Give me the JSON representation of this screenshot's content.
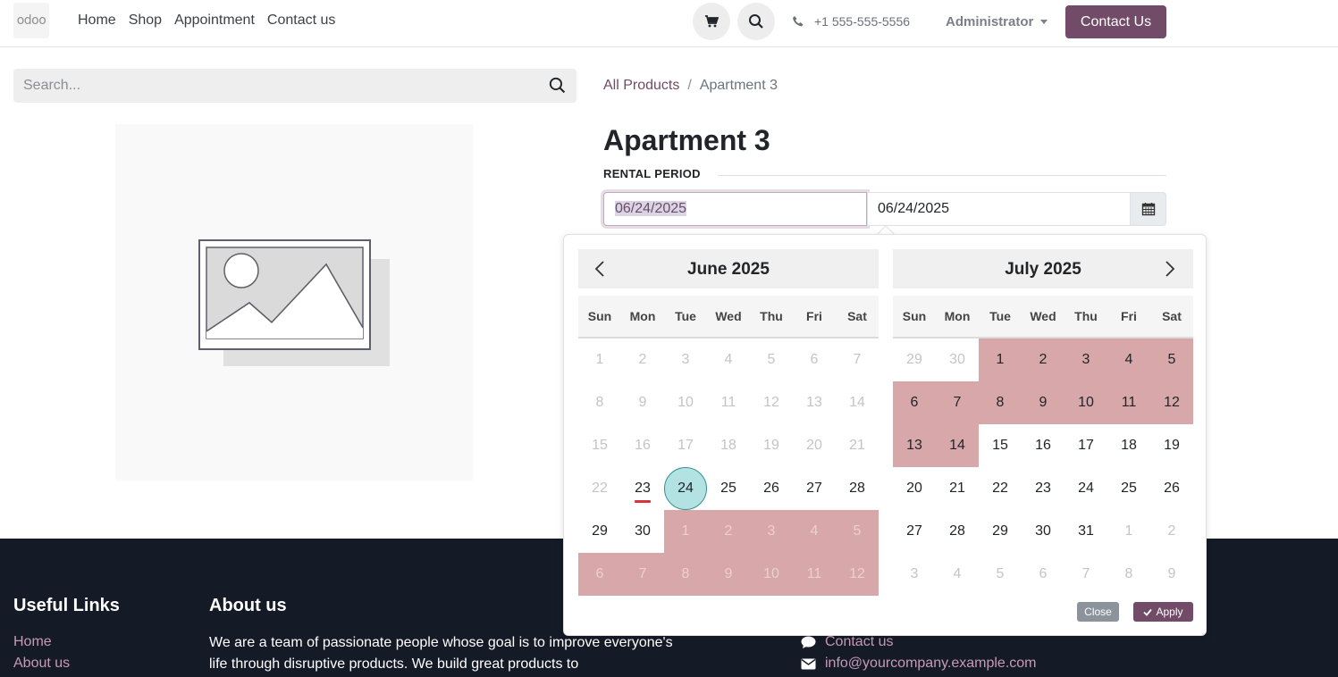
{
  "header": {
    "logo_text": "odoo",
    "nav": [
      "Home",
      "Shop",
      "Appointment",
      "Contact us"
    ],
    "phone": "+1 555-555-5556",
    "user": "Administrator",
    "contact_button": "Contact Us"
  },
  "search": {
    "placeholder": "Search..."
  },
  "breadcrumb": {
    "root": "All Products",
    "sep": "/",
    "current": "Apartment 3"
  },
  "product": {
    "title": "Apartment 3",
    "rental_label": "RENTAL PERIOD"
  },
  "dates": {
    "start": "06/24/2025",
    "end": "06/24/2025"
  },
  "picker": {
    "months": [
      "June 2025",
      "July 2025"
    ],
    "weekdays": [
      "Sun",
      "Mon",
      "Tue",
      "Wed",
      "Thu",
      "Fri",
      "Sat"
    ],
    "close_label": "Close",
    "apply_label": "Apply",
    "june_days": [
      "1",
      "2",
      "3",
      "4",
      "5",
      "6",
      "7",
      "8",
      "9",
      "10",
      "11",
      "12",
      "13",
      "14",
      "15",
      "16",
      "17",
      "18",
      "19",
      "20",
      "21",
      "22",
      "23",
      "24",
      "25",
      "26",
      "27",
      "28",
      "29",
      "30",
      "1",
      "2",
      "3",
      "4",
      "5",
      "6",
      "7",
      "8",
      "9",
      "10",
      "11",
      "12"
    ],
    "july_days": [
      "29",
      "30",
      "1",
      "2",
      "3",
      "4",
      "5",
      "6",
      "7",
      "8",
      "9",
      "10",
      "11",
      "12",
      "13",
      "14",
      "15",
      "16",
      "17",
      "18",
      "19",
      "20",
      "21",
      "22",
      "23",
      "24",
      "25",
      "26",
      "27",
      "28",
      "29",
      "30",
      "31",
      "1",
      "2",
      "3",
      "4",
      "5",
      "6",
      "7",
      "8",
      "9"
    ]
  },
  "footer": {
    "useful_links_title": "Useful Links",
    "about_title": "About us",
    "links": [
      "Home",
      "About us"
    ],
    "about_text": "We are a team of passionate people whose goal is to improve everyone's life through disruptive products. We build great products to",
    "contact_link": "Contact us",
    "email": "info@yourcompany.example.com"
  },
  "colors": {
    "brand": "#714b67",
    "range": "#d8a7a9",
    "selected": "#b2e2e2",
    "footer_bg": "#151a27"
  }
}
